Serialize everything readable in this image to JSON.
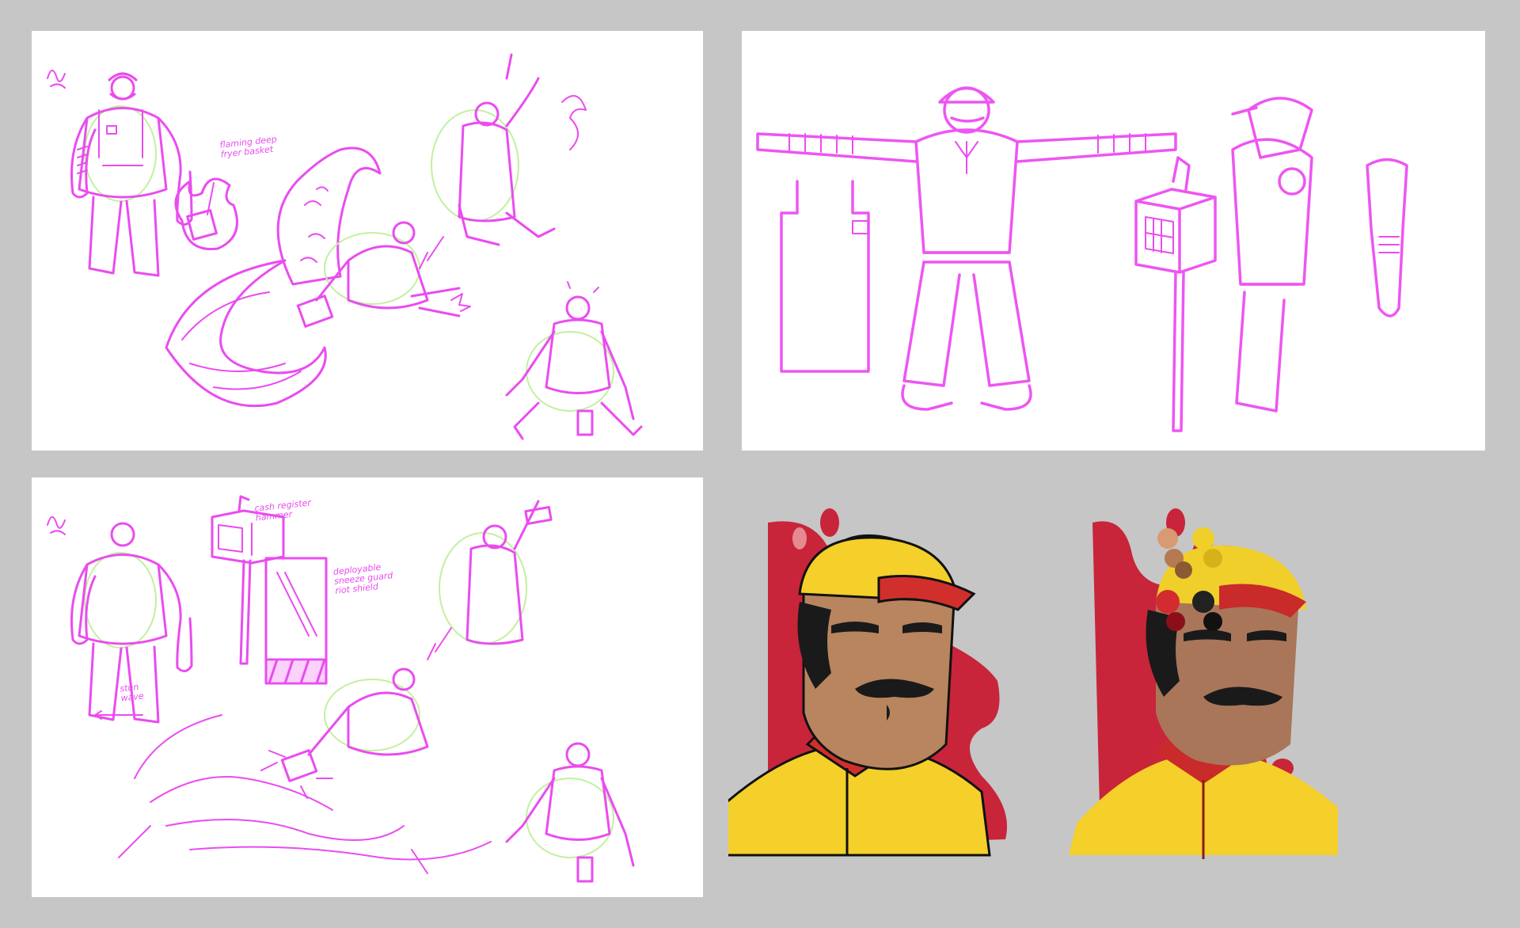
{
  "panels": {
    "p1": {
      "notes": [
        {
          "text": "flaming deep\nfryer basket"
        }
      ]
    },
    "p3": {
      "notes": [
        {
          "text": "cash register\nhammer"
        },
        {
          "text": "deployable\nsneeze guard\nriot shield"
        },
        {
          "text": "stun\nwave"
        }
      ]
    }
  },
  "colors": {
    "sketch_ink": "#ea4cf0",
    "sketch_underlay": "#c2f0a0",
    "splash_red": "#c8253a",
    "cap_yellow": "#f5cf2a",
    "skin": "#b8855f",
    "hair_black": "#1a1a1a"
  },
  "palette_swatches": [
    "#d89a72",
    "#b47a52",
    "#8b5a35",
    "#f1cf2a",
    "#d6b21a",
    "#d32b2f",
    "#8b0f1a",
    "#222222",
    "#111111"
  ]
}
